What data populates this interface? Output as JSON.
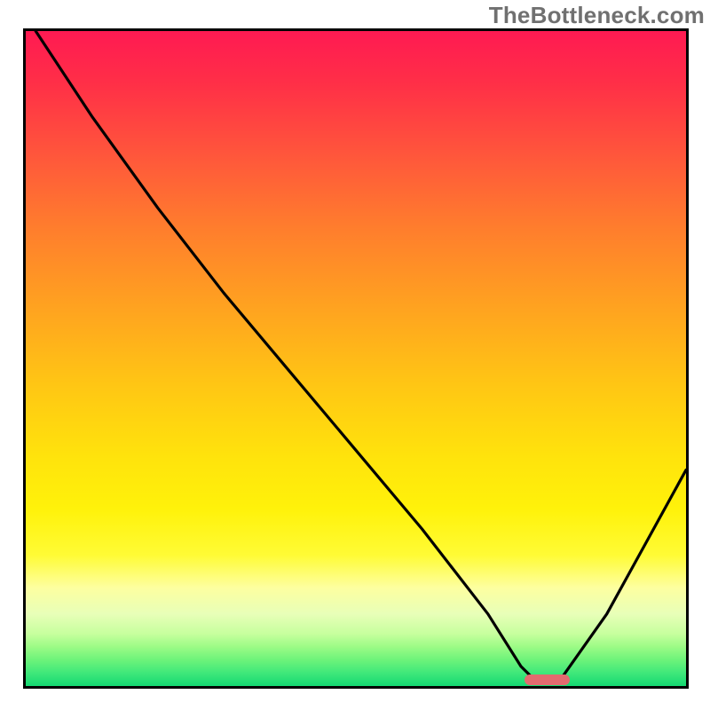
{
  "watermark": "TheBottleneck.com",
  "colors": {
    "stroke": "#000000",
    "marker": "#e36a6f",
    "gradient_top": "#ff1a52",
    "gradient_bottom": "#14d872"
  },
  "chart_data": {
    "type": "line",
    "title": "",
    "xlabel": "",
    "ylabel": "",
    "xlim": [
      0,
      100
    ],
    "ylim": [
      0,
      100
    ],
    "grid": false,
    "legend": false,
    "note": "V-shaped bottleneck curve over bottleneck-severity gradient; valley just below x≈77; left ascent originates at top-left with kink near x≈20,y≈73.",
    "series": [
      {
        "name": "bottleneck-curve",
        "x": [
          1.5,
          10,
          20,
          30,
          40,
          50,
          60,
          70,
          75,
          77,
          81,
          88,
          94,
          100
        ],
        "y": [
          100,
          87,
          73,
          60,
          48,
          36,
          24,
          11,
          3,
          1,
          1,
          11,
          22,
          33
        ]
      }
    ],
    "marker": {
      "x_center": 79,
      "width_pct": 6.9,
      "y": 1
    }
  }
}
